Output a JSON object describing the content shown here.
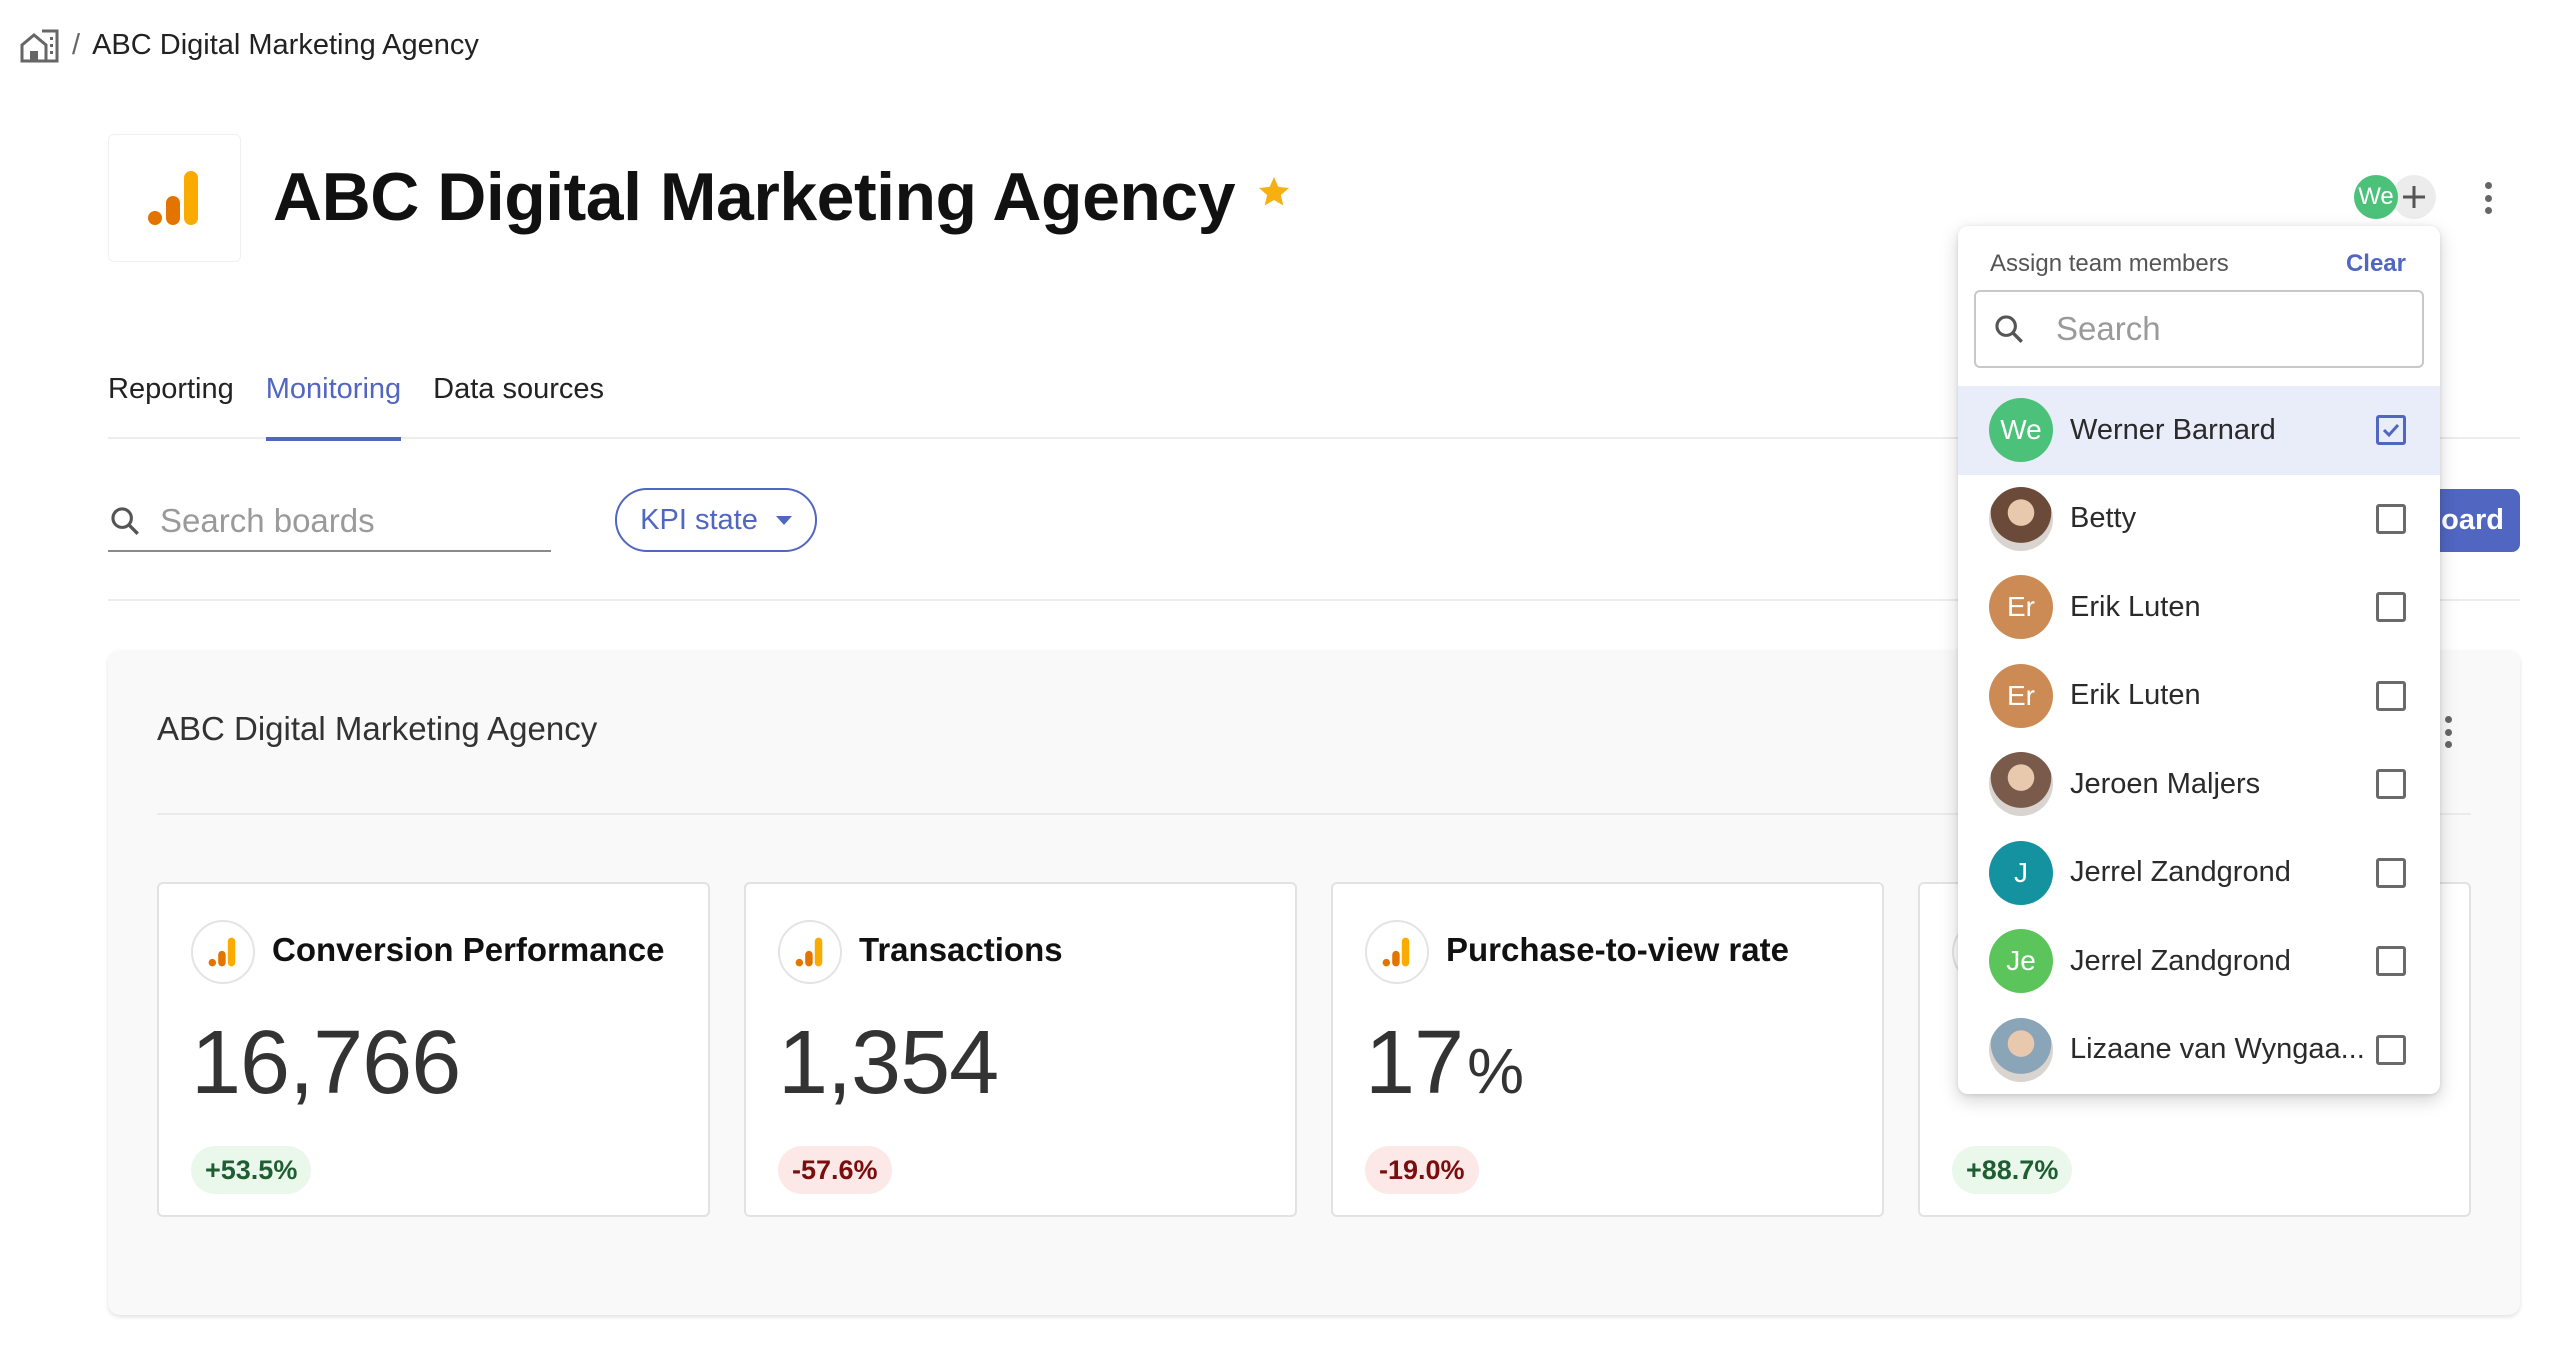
{
  "breadcrumb": {
    "home_icon": "building-home-icon",
    "separator": "/",
    "current": "ABC Digital Marketing Agency"
  },
  "header": {
    "title": "ABC Digital Marketing Agency",
    "logo_icon": "analytics-bars-icon",
    "favorite_icon": "star-icon",
    "favorited": true,
    "assignee_initials": "We",
    "add_member_icon": "plus-icon",
    "more_icon": "kebab-menu-icon"
  },
  "colors": {
    "accent": "#5166c0",
    "star": "#f6b012",
    "logo_orange": "#e37400",
    "logo_yellow": "#f9ab00",
    "positive_bg": "#eaf8ec",
    "positive_text": "#1f5e33",
    "negative_bg": "#fde8e8",
    "negative_text": "#7a0d0d"
  },
  "tabs": [
    {
      "label": "Reporting",
      "active": false
    },
    {
      "label": "Monitoring",
      "active": true
    },
    {
      "label": "Data sources",
      "active": false
    }
  ],
  "toolbar": {
    "search_placeholder": "Search boards",
    "search_value": "",
    "filter_label": "KPI state",
    "new_board_label_visible": "oard"
  },
  "board": {
    "title": "ABC Digital Marketing Agency",
    "cards": [
      {
        "title": "Conversion Performance",
        "value": "16,766",
        "unit": "",
        "change": "+53.5%",
        "trend": "up"
      },
      {
        "title": "Transactions",
        "value": "1,354",
        "unit": "",
        "change": "-57.6%",
        "trend": "down"
      },
      {
        "title": "Purchase-to-view rate",
        "value": "17",
        "unit": "%",
        "change": "-19.0%",
        "trend": "down"
      },
      {
        "title": "",
        "value": "",
        "unit": "",
        "change": "+88.7%",
        "trend": "up"
      }
    ]
  },
  "assign_dropdown": {
    "heading": "Assign team members",
    "clear_label": "Clear",
    "search_placeholder": "Search",
    "search_value": "",
    "members": [
      {
        "name": "Werner Barnard",
        "initials": "We",
        "avatar_type": "initials",
        "color": "#4cc17a",
        "checked": true
      },
      {
        "name": "Betty",
        "initials": "",
        "avatar_type": "photo",
        "color": "#6b4a3a",
        "checked": false
      },
      {
        "name": "Erik Luten",
        "initials": "Er",
        "avatar_type": "initials",
        "color": "#cc8a55",
        "checked": false
      },
      {
        "name": "Erik Luten",
        "initials": "Er",
        "avatar_type": "initials",
        "color": "#cc8a55",
        "checked": false
      },
      {
        "name": "Jeroen Maljers",
        "initials": "",
        "avatar_type": "photo",
        "color": "#7a5a4a",
        "checked": false
      },
      {
        "name": "Jerrel Zandgrond",
        "initials": "J",
        "avatar_type": "initials",
        "color": "#1592a0",
        "checked": false
      },
      {
        "name": "Jerrel Zandgrond",
        "initials": "Je",
        "avatar_type": "initials",
        "color": "#5bc55b",
        "checked": false
      },
      {
        "name": "Lizaane van Wyngaa...",
        "initials": "",
        "avatar_type": "photo",
        "color": "#8aa4b8",
        "checked": false
      }
    ]
  }
}
